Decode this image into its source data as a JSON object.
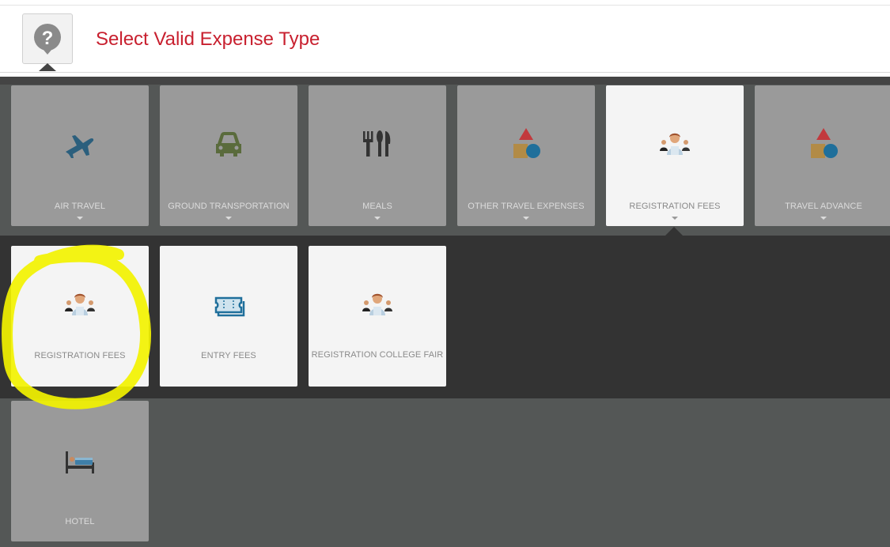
{
  "header": {
    "help_icon": "question-circle-icon",
    "title": "Select Valid Expense Type"
  },
  "categories": [
    {
      "label": "AIR TRAVEL",
      "icon": "airplane-icon",
      "selected": false
    },
    {
      "label": "GROUND TRANSPORTATION",
      "icon": "car-icon",
      "selected": false
    },
    {
      "label": "MEALS",
      "icon": "fork-knife-icon",
      "selected": false
    },
    {
      "label": "OTHER TRAVEL EXPENSES",
      "icon": "shapes-icon",
      "selected": false
    },
    {
      "label": "REGISTRATION FEES",
      "icon": "people-icon",
      "selected": true
    },
    {
      "label": "TRAVEL ADVANCE",
      "icon": "shapes-icon",
      "selected": false
    }
  ],
  "subtypes": [
    {
      "label": "REGISTRATION FEES",
      "icon": "people-icon"
    },
    {
      "label": "ENTRY FEES",
      "icon": "ticket-icon"
    },
    {
      "label": "REGISTRATION COLLEGE FAIR",
      "icon": "people-icon"
    }
  ],
  "more_categories": [
    {
      "label": "HOTEL",
      "icon": "bed-icon"
    }
  ],
  "colors": {
    "title": "#c8202f",
    "highlight": "#f2f200",
    "panel": "#545756",
    "subpanel": "#333333"
  }
}
